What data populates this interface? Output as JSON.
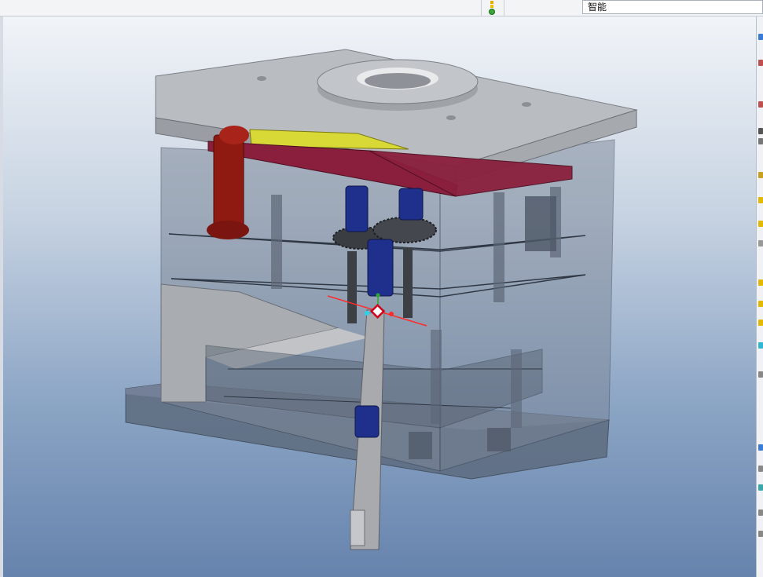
{
  "toolbar": {
    "filter_label": "智能"
  },
  "viewport": {
    "model": "mold-assembly"
  },
  "colors": {
    "background_top": "#f1f4f8",
    "background_bottom": "#6683ad",
    "plate": "#b9bcc0",
    "leader_pin": "#8e1a12",
    "ejector_plate": "#8a1f3d",
    "slider": "#d8d836",
    "sleeve": "#1f2f8c",
    "datum_axis": "#ff2a2a"
  }
}
